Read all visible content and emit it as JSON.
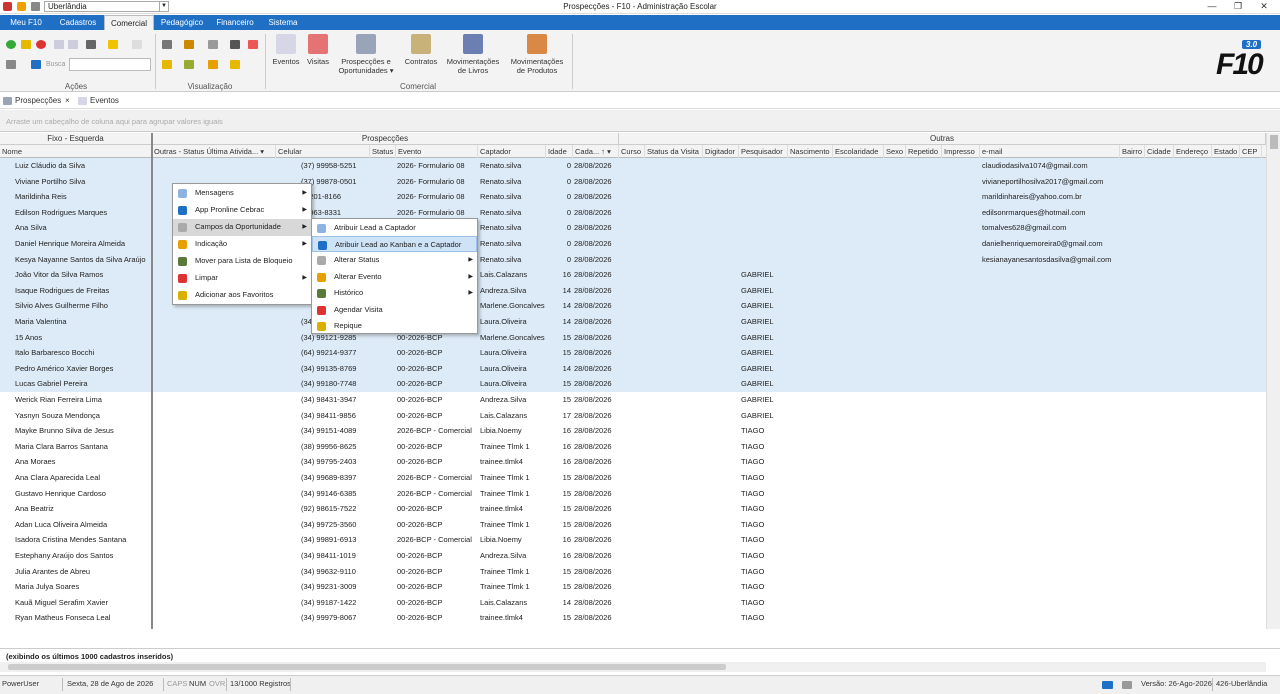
{
  "window": {
    "title": "Prospecções - F10 - Administração Escolar",
    "city": "Uberlândia"
  },
  "menu_tabs": [
    "Meu F10",
    "Cadastros",
    "Comercial",
    "Pedagógico",
    "Financeiro",
    "Sistema"
  ],
  "ribbon": {
    "busca_label": "Busca",
    "groups": {
      "acoes": "Ações",
      "visualizacao": "Visualização",
      "comercial": "Comercial"
    },
    "buttons": {
      "eventos": "Eventos",
      "visitas": "Visitas",
      "prospeccoes1": "Prospecções e",
      "prospeccoes2": "Oportunidades ▾",
      "contratos": "Contratos",
      "mov_livros1": "Movimentações",
      "mov_livros2": "de Livros",
      "mov_produtos1": "Movimentações",
      "mov_produtos2": "de Produtos"
    },
    "logo_version": "3.0",
    "logo_text": "F10"
  },
  "doc_tabs": {
    "prospeccoes": "Prospecções",
    "eventos": "Eventos",
    "close": "×"
  },
  "group_panel_hint": "Arraste um cabeçalho de coluna aqui para agrupar valores iguais",
  "grid": {
    "bands": {
      "fixo": "Fixo - Esquerda",
      "prospeccoes": "Prospecções",
      "outras": "Outras"
    },
    "columns": {
      "nome": "Nome",
      "outras_status": "Outras - Status Última Ativida... ▾",
      "celular": "Celular",
      "status": "Status",
      "evento": "Evento",
      "captador": "Captador",
      "idade": "Idade",
      "cadastro": "Cada... ↑ ▾",
      "curso": "Curso",
      "status_visita": "Status da Visita",
      "digitador": "Digitador",
      "pesquisador": "Pesquisador",
      "nascimento": "Nascimento",
      "escolaridade": "Escolaridade",
      "sexo": "Sexo",
      "repetido": "Repetido",
      "impresso": "Impresso",
      "email": "e-mail",
      "bairro": "Bairro",
      "cidade": "Cidade",
      "endereco": "Endereço",
      "estado": "Estado",
      "cep": "CEP"
    },
    "rows": [
      {
        "nome": "Luiz Cláudio da Silva",
        "celular": "(37) 99958-5251",
        "evento": "2026- Formulario 08",
        "captador": "Renato.silva",
        "idade": "0",
        "cadastro": "28/08/2026",
        "pesquisador": "",
        "email": "claudiodasilva1074@gmail.com"
      },
      {
        "nome": "Viviane Portilho Silva",
        "celular": "(37) 99878-0501",
        "evento": "2026- Formulario 08",
        "captador": "Renato.silva",
        "idade": "0",
        "cadastro": "28/08/2026",
        "pesquisador": "",
        "email": "vivianeportilhosilva2017@gmail.com"
      },
      {
        "nome": "Marildinha Reis",
        "celular": "99201-8166",
        "evento": "2026- Formulario 08",
        "captador": "Renato.silva",
        "idade": "0",
        "cadastro": "28/08/2026",
        "pesquisador": "",
        "email": "marildinhareis@yahoo.com.br"
      },
      {
        "nome": "Edilson Rodrigues Marques",
        "celular": "99963-8331",
        "evento": "2026- Formulario 08",
        "captador": "Renato.silva",
        "idade": "0",
        "cadastro": "28/08/2026",
        "pesquisador": "",
        "email": "edilsonrmarques@hotmail.com"
      },
      {
        "nome": "Ana Silva",
        "celular": "",
        "evento": "",
        "captador": "Renato.silva",
        "idade": "0",
        "cadastro": "28/08/2026",
        "pesquisador": "",
        "email": "tomalves628@gmail.com"
      },
      {
        "nome": "Daniel Henrique Moreira Almeida",
        "celular": "",
        "evento": "",
        "captador": "Renato.silva",
        "idade": "0",
        "cadastro": "28/08/2026",
        "pesquisador": "",
        "email": "danielhenriquemoreira0@gmail.com"
      },
      {
        "nome": "Kesya Nayanne Santos da Silva Araújo",
        "celular": "",
        "evento": "",
        "captador": "Renato.silva",
        "idade": "0",
        "cadastro": "28/08/2026",
        "pesquisador": "",
        "email": "kesianayanesantosdasilva@gmail.com"
      },
      {
        "nome": "João Vitor da Silva Ramos",
        "celular": "",
        "evento": "",
        "captador": "Lais.Calazans",
        "idade": "16",
        "cadastro": "28/08/2026",
        "pesquisador": "GABRIEL",
        "email": ""
      },
      {
        "nome": "Isaque Rodrigues de Freitas",
        "celular": "",
        "evento": "",
        "captador": "Andreza.Silva",
        "idade": "14",
        "cadastro": "28/08/2026",
        "pesquisador": "GABRIEL",
        "email": ""
      },
      {
        "nome": "Silvio Alves Guilherme Filho",
        "celular": "",
        "evento": "",
        "captador": "Marlene.Goncalves",
        "idade": "14",
        "cadastro": "28/08/2026",
        "pesquisador": "GABRIEL",
        "email": ""
      },
      {
        "nome": "Maria Valentina",
        "celular": "(34",
        "evento": "",
        "captador": "Laura.Oliveira",
        "idade": "14",
        "cadastro": "28/08/2026",
        "pesquisador": "GABRIEL",
        "email": ""
      },
      {
        "nome": "15 Anos",
        "celular": "(34) 99121-9285",
        "evento": "00-2026-BCP",
        "captador": "Marlene.Goncalves",
        "idade": "15",
        "cadastro": "28/08/2026",
        "pesquisador": "GABRIEL",
        "email": ""
      },
      {
        "nome": "Italo Barbaresco Bocchi",
        "celular": "(64) 99214-9377",
        "evento": "00-2026-BCP",
        "captador": "Laura.Oliveira",
        "idade": "15",
        "cadastro": "28/08/2026",
        "pesquisador": "GABRIEL",
        "email": ""
      },
      {
        "nome": "Pedro Américo Xavier Borges",
        "celular": "(34) 99135-8769",
        "evento": "00-2026-BCP",
        "captador": "Laura.Oliveira",
        "idade": "14",
        "cadastro": "28/08/2026",
        "pesquisador": "GABRIEL",
        "email": ""
      },
      {
        "nome": "Lucas Gabriel Pereira",
        "celular": "(34) 99180-7748",
        "evento": "00-2026-BCP",
        "captador": "Laura.Oliveira",
        "idade": "15",
        "cadastro": "28/08/2026",
        "pesquisador": "GABRIEL",
        "email": ""
      },
      {
        "nome": "Werick Rian Ferreira Lima",
        "celular": "(34) 98431-3947",
        "evento": "00-2026-BCP",
        "captador": "Andreza.Silva",
        "idade": "15",
        "cadastro": "28/08/2026",
        "pesquisador": "GABRIEL",
        "email": ""
      },
      {
        "nome": "Yasnyn Souza Mendonça",
        "celular": "(34) 98411-9856",
        "evento": "00-2026-BCP",
        "captador": "Lais.Calazans",
        "idade": "17",
        "cadastro": "28/08/2026",
        "pesquisador": "GABRIEL",
        "email": ""
      },
      {
        "nome": "Mayke Brunno Silva de Jesus",
        "celular": "(34) 99151-4089",
        "evento": "2026-BCP - Comercial",
        "captador": "Libia.Noemy",
        "idade": "16",
        "cadastro": "28/08/2026",
        "pesquisador": "TIAGO",
        "email": ""
      },
      {
        "nome": "Maria Clara Barros Santana",
        "celular": "(38) 99956-8625",
        "evento": "00-2026-BCP",
        "captador": "Trainee Tlmk 1",
        "idade": "16",
        "cadastro": "28/08/2026",
        "pesquisador": "TIAGO",
        "email": ""
      },
      {
        "nome": "Ana Moraes",
        "celular": "(34) 99795-2403",
        "evento": "00-2026-BCP",
        "captador": "trainee.tlmk4",
        "idade": "16",
        "cadastro": "28/08/2026",
        "pesquisador": "TIAGO",
        "email": ""
      },
      {
        "nome": "Ana Clara Aparecida Leal",
        "celular": "(34) 99689-8397",
        "evento": "2026-BCP - Comercial",
        "captador": "Trainee Tlmk 1",
        "idade": "15",
        "cadastro": "28/08/2026",
        "pesquisador": "TIAGO",
        "email": ""
      },
      {
        "nome": "Gustavo Henrique Cardoso",
        "celular": "(34) 99146-6385",
        "evento": "2026-BCP - Comercial",
        "captador": "Trainee Tlmk 1",
        "idade": "15",
        "cadastro": "28/08/2026",
        "pesquisador": "TIAGO",
        "email": ""
      },
      {
        "nome": "Ana Beatriz",
        "celular": "(92) 98615-7522",
        "evento": "00-2026-BCP",
        "captador": "trainee.tlmk4",
        "idade": "15",
        "cadastro": "28/08/2026",
        "pesquisador": "TIAGO",
        "email": ""
      },
      {
        "nome": "Adan Luca Oliveira Almeida",
        "celular": "(34) 99725-3560",
        "evento": "00-2026-BCP",
        "captador": "Trainee Tlmk 1",
        "idade": "15",
        "cadastro": "28/08/2026",
        "pesquisador": "TIAGO",
        "email": ""
      },
      {
        "nome": "Isadora Cristina Mendes Santana",
        "celular": "(34) 99891-6913",
        "evento": "2026-BCP - Comercial",
        "captador": "Libia.Noemy",
        "idade": "16",
        "cadastro": "28/08/2026",
        "pesquisador": "TIAGO",
        "email": ""
      },
      {
        "nome": "Estephany Araújo dos Santos",
        "celular": "(34) 98411-1019",
        "evento": "00-2026-BCP",
        "captador": "Andreza.Silva",
        "idade": "16",
        "cadastro": "28/08/2026",
        "pesquisador": "TIAGO",
        "email": ""
      },
      {
        "nome": "Julia Arantes de Abreu",
        "celular": "(34) 99632-9110",
        "evento": "00-2026-BCP",
        "captador": "Trainee Tlmk 1",
        "idade": "15",
        "cadastro": "28/08/2026",
        "pesquisador": "TIAGO",
        "email": ""
      },
      {
        "nome": "Maria Julya Soares",
        "celular": "(34) 99231-3009",
        "evento": "00-2026-BCP",
        "captador": "Trainee Tlmk 1",
        "idade": "15",
        "cadastro": "28/08/2026",
        "pesquisador": "TIAGO",
        "email": ""
      },
      {
        "nome": "Kauã Miguel Serafim Xavier",
        "celular": "(34) 99187-1422",
        "evento": "00-2026-BCP",
        "captador": "Lais.Calazans",
        "idade": "14",
        "cadastro": "28/08/2026",
        "pesquisador": "TIAGO",
        "email": ""
      },
      {
        "nome": "Ryan Matheus Fonseca Leal",
        "celular": "(34) 99979-8067",
        "evento": "00-2026-BCP",
        "captador": "trainee.tlmk4",
        "idade": "15",
        "cadastro": "28/08/2026",
        "pesquisador": "TIAGO",
        "email": ""
      }
    ],
    "footer": "(exibindo os últimos 1000 cadastros inseridos)"
  },
  "context_menu": {
    "items": [
      {
        "label": "Mensagens",
        "icon": "message-icon",
        "submenu": true
      },
      {
        "label": "App Pronline Cebrac",
        "icon": "app-icon",
        "submenu": true
      },
      {
        "label": "Campos da Oportunidade",
        "icon": "fields-icon",
        "submenu": true
      },
      {
        "label": "Indicação",
        "icon": "referral-icon",
        "submenu": true
      },
      {
        "label": "Mover para Lista de Bloqueio",
        "icon": "block-list-icon",
        "submenu": false
      },
      {
        "label": "Limpar",
        "icon": "eraser-icon",
        "submenu": true
      },
      {
        "label": "Adicionar aos Favoritos",
        "icon": "star-icon",
        "submenu": false
      }
    ]
  },
  "sub_menu": {
    "items": [
      {
        "label": "Atribuir Lead a Captador",
        "icon": "assign-user-icon",
        "submenu": false
      },
      {
        "label": "Atribuir Lead ao Kanban e a Captador",
        "icon": "kanban-icon",
        "submenu": false
      },
      {
        "label": "Alterar Status",
        "icon": "status-icon",
        "submenu": true
      },
      {
        "label": "Alterar Evento",
        "icon": "event-icon",
        "submenu": true
      },
      {
        "label": "Histórico",
        "icon": "history-icon",
        "submenu": true
      },
      {
        "label": "Agendar Visita",
        "icon": "calendar-icon",
        "submenu": false
      },
      {
        "label": "Repique",
        "icon": "repeat-icon",
        "submenu": false
      }
    ]
  },
  "statusbar": {
    "user": "PowerUser",
    "date": "Sexta, 28 de Ago de 2026",
    "caps": "CAPS",
    "num": "NUM",
    "ovr": "OVR",
    "records": "13/1000 Registros",
    "version": "Versão: 26-Ago-2026",
    "unit": "426-Uberlândia"
  },
  "colors": {
    "accent": "#1f6fc5",
    "row_alt": "#ddeaf7",
    "menu_highlight": "#cfe3f7"
  }
}
